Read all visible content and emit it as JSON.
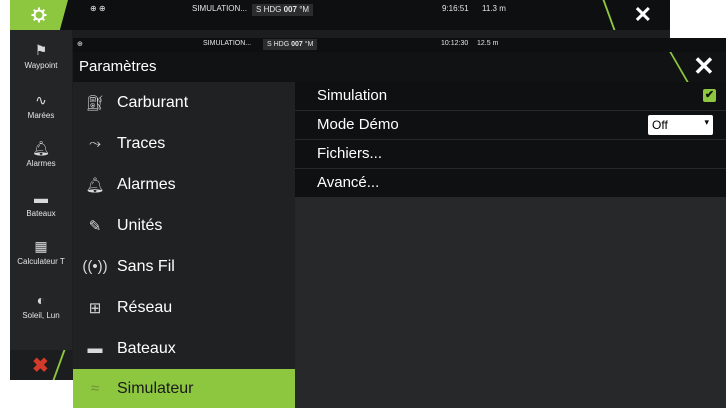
{
  "back_window": {
    "status": {
      "icons": "⊕ ⊕",
      "mode": "SIMULATION...",
      "hdg_prefix": "S",
      "hdg_label": "HDG",
      "hdg_value": "007",
      "hdg_unit": "°M",
      "time": "9:16:51",
      "distance": "11.3 m"
    },
    "sidebar": [
      {
        "label": "Waypoint",
        "icon": "flag-icon"
      },
      {
        "label": "Marées",
        "icon": "wave-icon"
      },
      {
        "label": "Alarmes",
        "icon": "bell-icon"
      },
      {
        "label": "Bateaux",
        "icon": "boat-icon"
      },
      {
        "label": "Calculateur T",
        "icon": "calculator-icon"
      },
      {
        "label": "Soleil, Lun",
        "icon": "sun-moon-icon"
      }
    ]
  },
  "front_window": {
    "status": {
      "icons": "⊕",
      "mode": "SIMULATION...",
      "hdg_prefix": "S",
      "hdg_label": "HDG",
      "hdg_value": "007",
      "hdg_unit": "°M",
      "time": "10:12:30",
      "distance": "12.5 m"
    },
    "title": "Paramètres",
    "menu": [
      {
        "label": "Carburant",
        "icon": "fuel-icon"
      },
      {
        "label": "Traces",
        "icon": "track-icon"
      },
      {
        "label": "Alarmes",
        "icon": "bell-icon"
      },
      {
        "label": "Unités",
        "icon": "pencil-icon"
      },
      {
        "label": "Sans Fil",
        "icon": "wireless-icon"
      },
      {
        "label": "Réseau",
        "icon": "network-icon"
      },
      {
        "label": "Bateaux",
        "icon": "boat-icon"
      },
      {
        "label": "Simulateur",
        "icon": "simulator-icon",
        "active": true
      }
    ],
    "panel": {
      "simulation": {
        "label": "Simulation",
        "checked": true
      },
      "demo_mode": {
        "label": "Mode Démo",
        "value": "Off"
      },
      "files": {
        "label": "Fichiers..."
      },
      "advanced": {
        "label": "Avancé..."
      }
    }
  },
  "colors": {
    "accent": "#8dc63f",
    "close_red": "#d23a2b",
    "menu_bg": "#1f2122",
    "row_bg": "#0f1011"
  }
}
